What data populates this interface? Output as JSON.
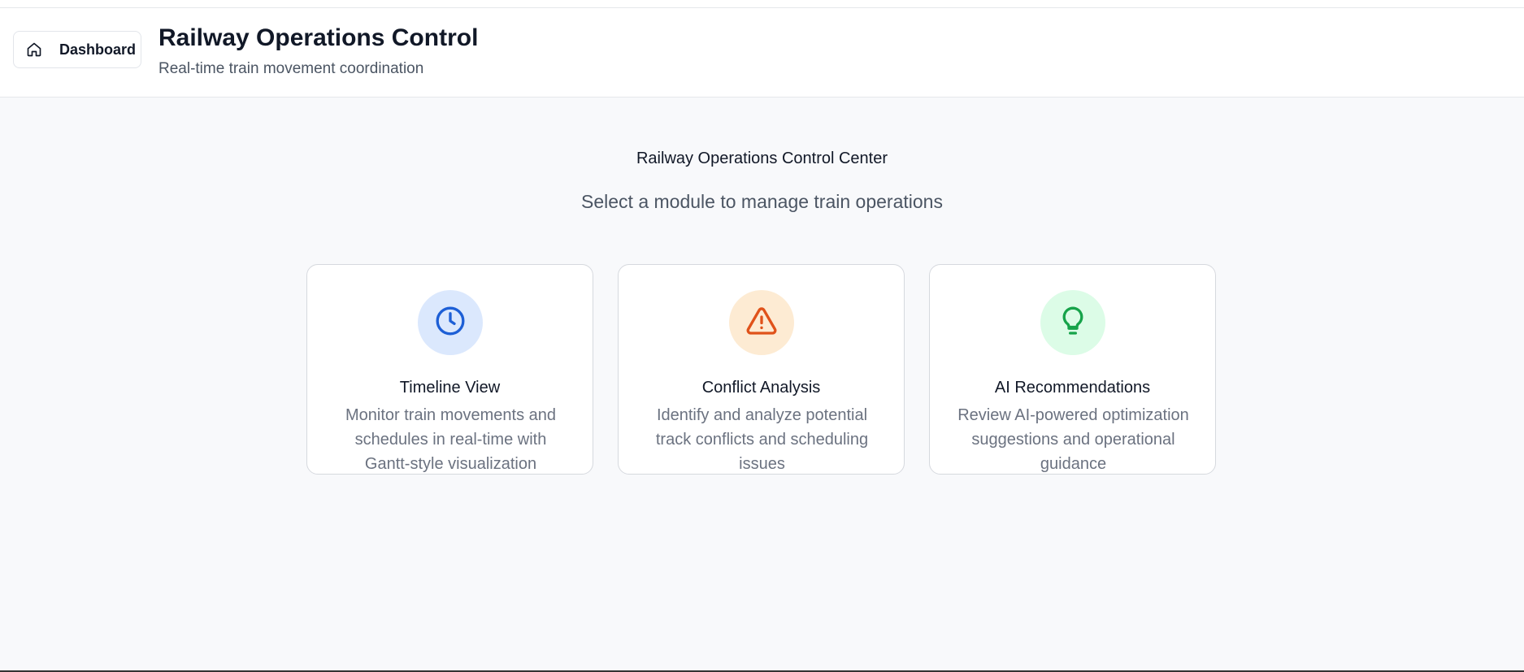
{
  "header": {
    "dashboard_label": "Dashboard",
    "title": "Railway Operations Control",
    "subtitle": "Real-time train movement coordination"
  },
  "main": {
    "title": "Railway Operations Control Center",
    "subtitle": "Select a module to manage train operations"
  },
  "modules": [
    {
      "title": "Timeline View",
      "description": "Monitor train movements and schedules in real-time with Gantt-style visualization",
      "icon": "clock-icon",
      "icon_color": "#1d5fd6",
      "icon_bg": "#dbe8fd"
    },
    {
      "title": "Conflict Analysis",
      "description": "Identify and analyze potential track conflicts and scheduling issues",
      "icon": "alert-triangle-icon",
      "icon_color": "#e0521a",
      "icon_bg": "#fdebd3"
    },
    {
      "title": "AI Recommendations",
      "description": "Review AI-powered optimization suggestions and operational guidance",
      "icon": "lightbulb-icon",
      "icon_color": "#16a34a",
      "icon_bg": "#dcfce7"
    }
  ]
}
